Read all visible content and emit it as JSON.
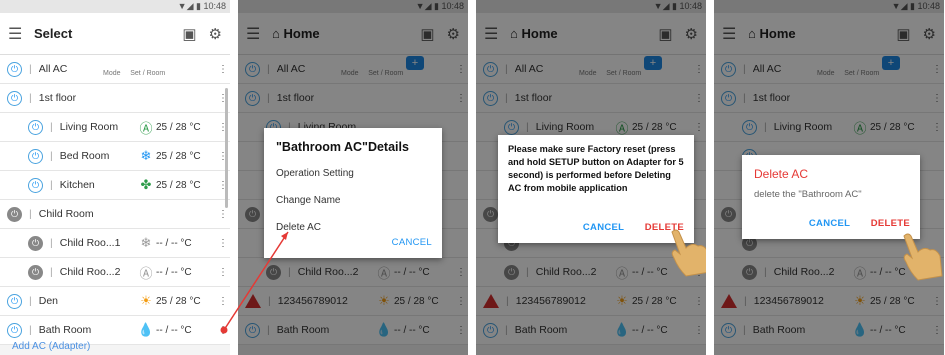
{
  "status": {
    "time": "10:48"
  },
  "screens": [
    {
      "title": "Select"
    },
    {
      "title": "Home"
    },
    {
      "title": "Home"
    },
    {
      "title": "Home"
    }
  ],
  "header": {
    "mode": "Mode",
    "set_room": "Set / Room"
  },
  "rows": {
    "all_ac": "All AC",
    "floor1": "1st floor",
    "living": "Living Room",
    "bed": "Bed Room",
    "kitchen": "Kitchen",
    "child": "Child Room",
    "child1": "Child Roo...1",
    "child2": "Child Roo...2",
    "den": "Den",
    "bath": "Bath Room",
    "code": "123456789012",
    "t25": "25 / 28  °C",
    "tnone": "-- / --   °C"
  },
  "add_link": "Add AC (Adapter)",
  "dialog_details": {
    "title": "\"Bathroom  AC\"Details",
    "opt1": "Operation Setting",
    "opt2": "Change Name",
    "opt3": "Delete AC",
    "cancel": "CANCEL"
  },
  "dialog_warn": {
    "text": "Please make sure Factory reset (press and hold SETUP button on Adapter for 5 second) is performed before Deleting AC from mobile application",
    "cancel": "CANCEL",
    "delete": "DELETE"
  },
  "dialog_delete": {
    "title": "Delete AC",
    "text": "delete the \"Bathroom AC\"",
    "cancel": "CANCEL",
    "delete": "DELETE"
  },
  "colors": {
    "accent": "#2196f3",
    "delete": "#e53935",
    "hand": "#e2b36a",
    "arrow": "#e53935"
  }
}
